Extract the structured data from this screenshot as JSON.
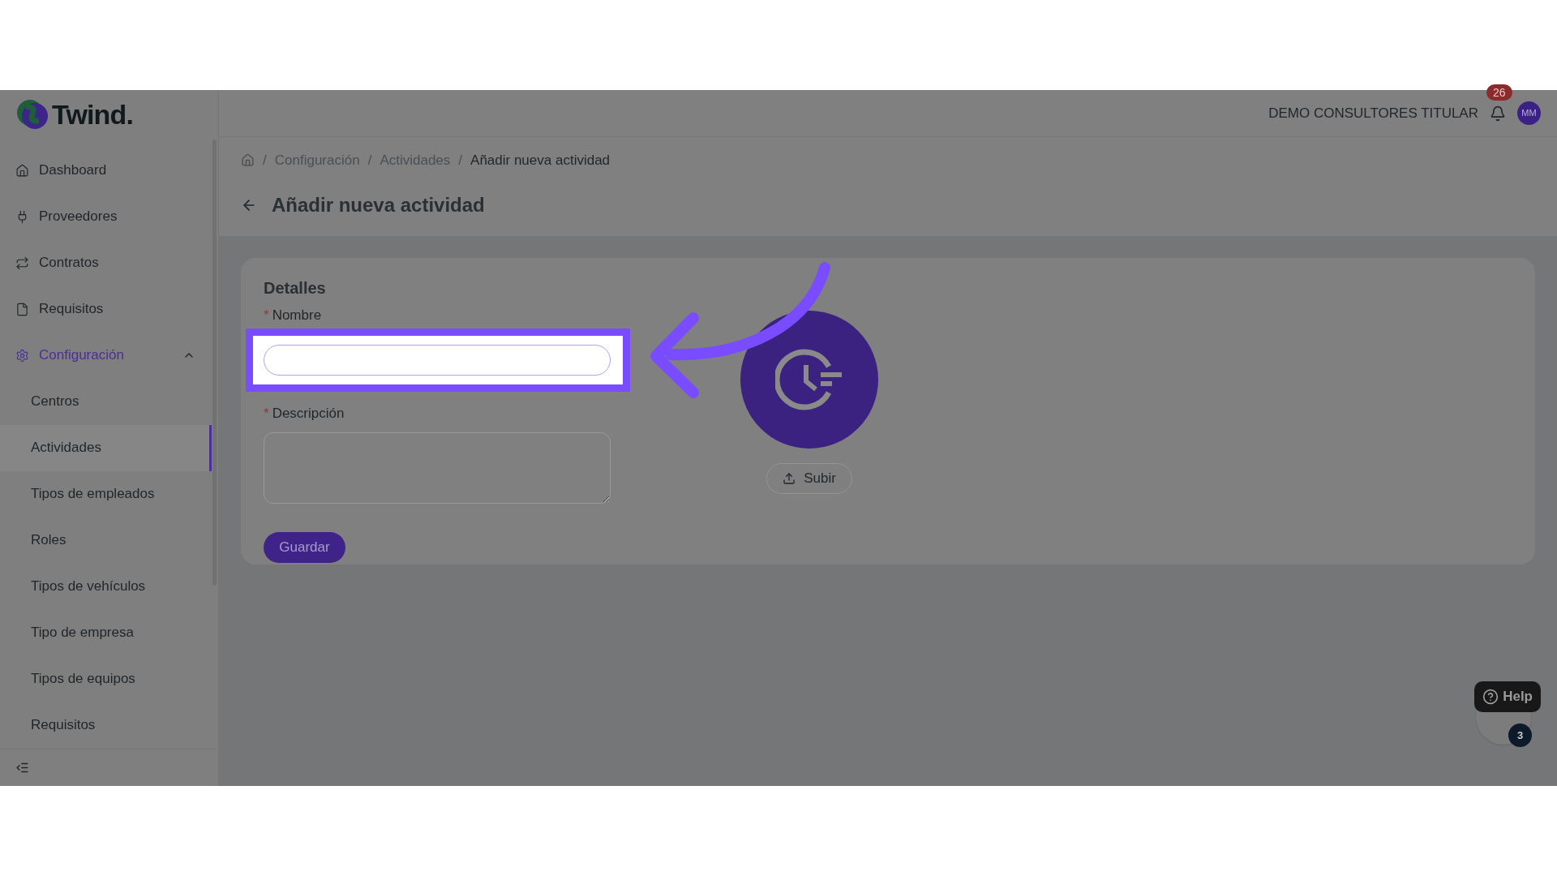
{
  "header": {
    "account": "DEMO CONSULTORES TITULAR",
    "notifications": "26",
    "avatar": "MM"
  },
  "sidebar": {
    "logo": "Twind.",
    "items": [
      {
        "label": "Dashboard",
        "selected": false
      },
      {
        "label": "Proveedores",
        "selected": false
      },
      {
        "label": "Contratos",
        "selected": false
      },
      {
        "label": "Requisitos",
        "selected": false
      },
      {
        "label": "Configuración",
        "selected": true,
        "expanded": true,
        "children": [
          {
            "label": "Centros",
            "selected": false
          },
          {
            "label": "Actividades",
            "selected": true
          },
          {
            "label": "Tipos de empleados",
            "selected": false
          },
          {
            "label": "Roles",
            "selected": false
          },
          {
            "label": "Tipos de vehículos",
            "selected": false
          },
          {
            "label": "Tipo de empresa",
            "selected": false
          },
          {
            "label": "Tipos de equipos",
            "selected": false
          },
          {
            "label": "Requisitos",
            "selected": false
          }
        ]
      }
    ]
  },
  "breadcrumb": [
    {
      "kind": "separator",
      "text": "/"
    },
    {
      "kind": "link",
      "text": "Configuración"
    },
    {
      "kind": "separator",
      "text": "/"
    },
    {
      "kind": "link",
      "text": "Actividades"
    },
    {
      "kind": "separator",
      "text": "/"
    },
    {
      "kind": "current",
      "text": "Añadir nueva actividad"
    }
  ],
  "title": "Añadir nueva actividad",
  "form": {
    "section": "Detalles",
    "fields": [
      {
        "label": "Nombre",
        "required_mark": "*",
        "kind": "input",
        "highlighted": true
      },
      {
        "label": "Descripción",
        "required_mark": "*",
        "kind": "textarea",
        "highlighted": false
      }
    ],
    "save": "Guardar",
    "upload": "Subir"
  },
  "help": {
    "label": "Help",
    "count": "3"
  }
}
